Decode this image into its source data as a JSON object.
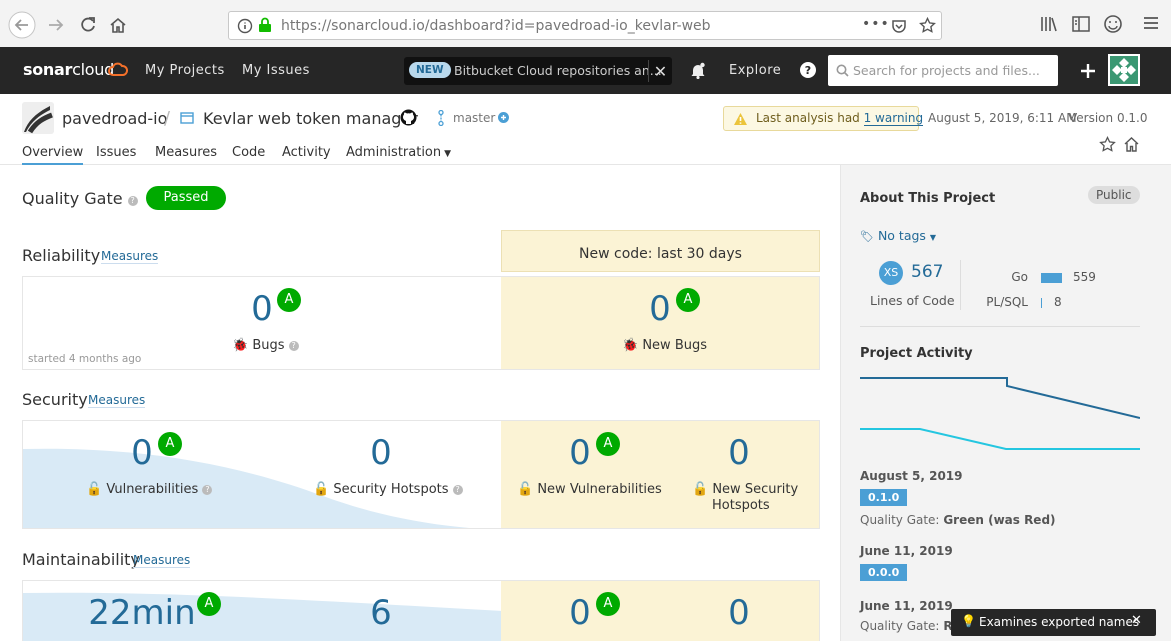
{
  "browser": {
    "url_host": "https://sonarcloud.io",
    "url_path": "/dashboard?id=pavedroad-io_kevlar-web",
    "url_menu": "•••"
  },
  "nav": {
    "logo_sonar": "sonar",
    "logo_cloud": "cloud",
    "my_projects": "My Projects",
    "my_issues": "My Issues",
    "promo_badge": "NEW",
    "promo_text": "Bitbucket Cloud repositories an...",
    "explore": "Explore",
    "search_placeholder": "Search for projects and files..."
  },
  "project": {
    "org": "pavedroad-io",
    "separator": "/",
    "name": "Kevlar web token manager",
    "branch": "master",
    "warning_text": "Last analysis had ",
    "warning_link": "1 warning",
    "date": "August 5, 2019, 6:11 AM",
    "version": "Version 0.1.0"
  },
  "tabs": [
    "Overview",
    "Issues",
    "Measures",
    "Code",
    "Activity",
    "Administration"
  ],
  "quality_gate": {
    "label": "Quality Gate",
    "status": "Passed"
  },
  "new_code_label": "New code: last 30 days",
  "reliability": {
    "title": "Reliability",
    "measures": "Measures",
    "bugs": "0",
    "bugs_rating": "A",
    "bugs_label": "Bugs",
    "started": "started 4 months ago",
    "new_bugs": "0",
    "new_bugs_rating": "A",
    "new_bugs_label": "New Bugs"
  },
  "security": {
    "title": "Security",
    "measures": "Measures",
    "vulns": "0",
    "vulns_rating": "A",
    "vulns_label": "Vulnerabilities",
    "hotspots": "0",
    "hotspots_label": "Security Hotspots",
    "new_vulns": "0",
    "new_vulns_rating": "A",
    "new_vulns_label": "New Vulnerabilities",
    "new_hotspots": "0",
    "new_hotspots_label_1": "New Security",
    "new_hotspots_label_2": "Hotspots"
  },
  "maintainability": {
    "title": "Maintainability",
    "measures": "Measures",
    "debt": "22min",
    "debt_rating": "A",
    "smells": "6",
    "new_debt": "0",
    "new_debt_rating": "A",
    "new_smells": "0"
  },
  "sidebar": {
    "about": "About This Project",
    "visibility": "Public",
    "tags": "No tags",
    "size_badge": "XS",
    "loc": "567",
    "loc_label": "Lines of Code",
    "languages": [
      {
        "name": "Go",
        "lines": "559",
        "share": 0.986
      },
      {
        "name": "PL/SQL",
        "lines": "8",
        "share": 0.014
      }
    ],
    "activity_title": "Project Activity",
    "events": [
      {
        "date": "August 5, 2019",
        "version": "0.1.0",
        "qg_label": "Quality Gate:",
        "qg_value": "Green (was Red)"
      },
      {
        "date": "June 11, 2019",
        "version": "0.0.0"
      },
      {
        "date": "June 11, 2019",
        "qg_label": "Quality Gate:",
        "qg_value": "Re"
      }
    ]
  },
  "toast": "Examines exported names",
  "colors": {
    "accent": "#236a97",
    "pass": "#00aa00",
    "new_code_bg": "#fbf3d5",
    "nav_bg": "#262626"
  }
}
